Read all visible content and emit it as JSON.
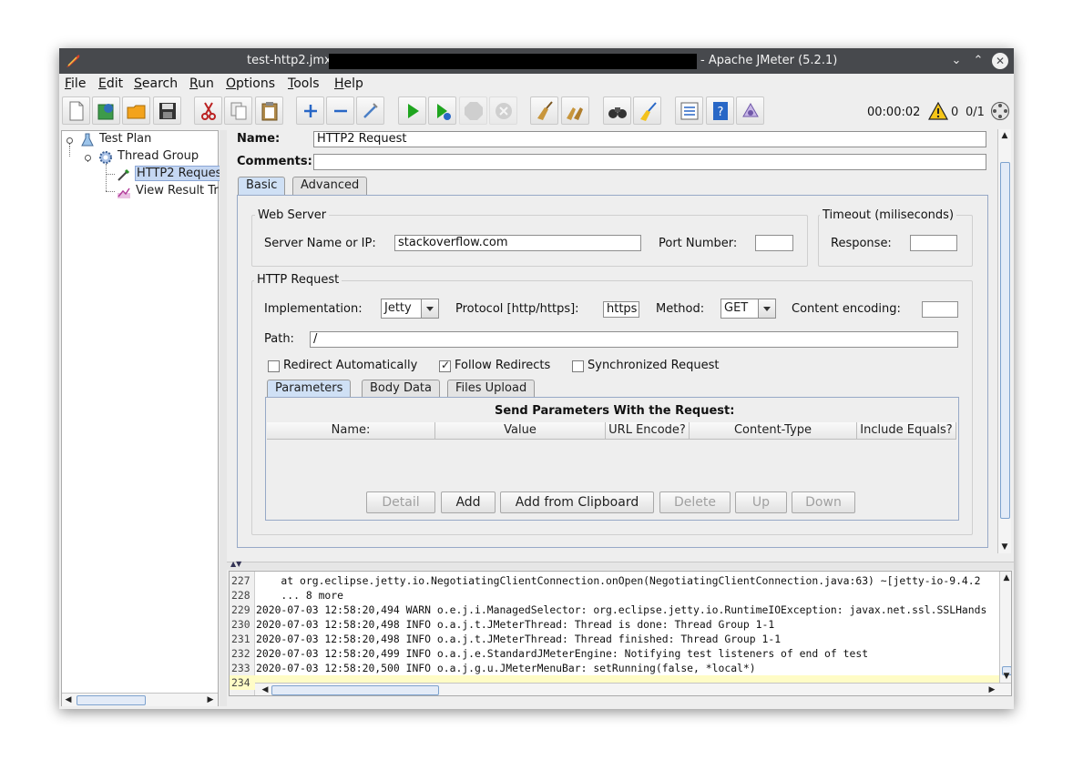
{
  "window": {
    "file": "test-http2.jmx",
    "app": "- Apache JMeter (5.2.1)"
  },
  "menu": [
    "File",
    "Edit",
    "Search",
    "Run",
    "Options",
    "Tools",
    "Help"
  ],
  "toolbar": {
    "timer": "00:00:02",
    "warnings": "0",
    "threads": "0/1"
  },
  "tree": {
    "test_plan": "Test Plan",
    "thread_group": "Thread Group",
    "http2_request": "HTTP2 Reques",
    "view_results": "View Result Tr"
  },
  "editor": {
    "name_label": "Name:",
    "name_value": "HTTP2 Request",
    "comments_label": "Comments:",
    "comments_value": "",
    "tabs": [
      "Basic",
      "Advanced"
    ],
    "web_server": {
      "title": "Web Server",
      "server_label": "Server Name or IP:",
      "server_value": "stackoverflow.com",
      "port_label": "Port Number:",
      "port_value": ""
    },
    "timeout": {
      "title": "Timeout (miliseconds)",
      "response_label": "Response:",
      "response_value": ""
    },
    "http_request": {
      "title": "HTTP Request",
      "impl_label": "Implementation:",
      "impl_value": "Jetty",
      "protocol_label": "Protocol [http/https]:",
      "protocol_value": "https",
      "method_label": "Method:",
      "method_value": "GET",
      "encoding_label": "Content encoding:",
      "encoding_value": "",
      "path_label": "Path:",
      "path_value": "/",
      "redirect_auto": "Redirect Automatically",
      "follow_redirects": "Follow Redirects",
      "sync_request": "Synchronized Request"
    },
    "param_tabs": [
      "Parameters",
      "Body Data",
      "Files Upload"
    ],
    "params_caption": "Send Parameters With the Request:",
    "columns": [
      "Name:",
      "Value",
      "URL Encode?",
      "Content-Type",
      "Include Equals?"
    ],
    "buttons": [
      "Detail",
      "Add",
      "Add from Clipboard",
      "Delete",
      "Up",
      "Down"
    ]
  },
  "log": [
    {
      "n": "227",
      "t": "    at org.eclipse.jetty.io.NegotiatingClientConnection.onOpen(NegotiatingClientConnection.java:63) ~[jetty-io-9.4.2"
    },
    {
      "n": "228",
      "t": "    ... 8 more"
    },
    {
      "n": "229",
      "t": "2020-07-03 12:58:20,494 WARN o.e.j.i.ManagedSelector: org.eclipse.jetty.io.RuntimeIOException: javax.net.ssl.SSLHands"
    },
    {
      "n": "230",
      "t": "2020-07-03 12:58:20,498 INFO o.a.j.t.JMeterThread: Thread is done: Thread Group 1-1"
    },
    {
      "n": "231",
      "t": "2020-07-03 12:58:20,498 INFO o.a.j.t.JMeterThread: Thread finished: Thread Group 1-1"
    },
    {
      "n": "232",
      "t": "2020-07-03 12:58:20,499 INFO o.a.j.e.StandardJMeterEngine: Notifying test listeners of end of test"
    },
    {
      "n": "233",
      "t": "2020-07-03 12:58:20,500 INFO o.a.j.g.u.JMeterMenuBar: setRunning(false, *local*)"
    },
    {
      "n": "234",
      "t": ""
    }
  ],
  "colors": {
    "titlebar": "#47494d",
    "selection": "#c5d7f2",
    "active_tab": "#cfe0f5",
    "current_line": "#fffcc6",
    "run_green": "#1fa51f"
  }
}
